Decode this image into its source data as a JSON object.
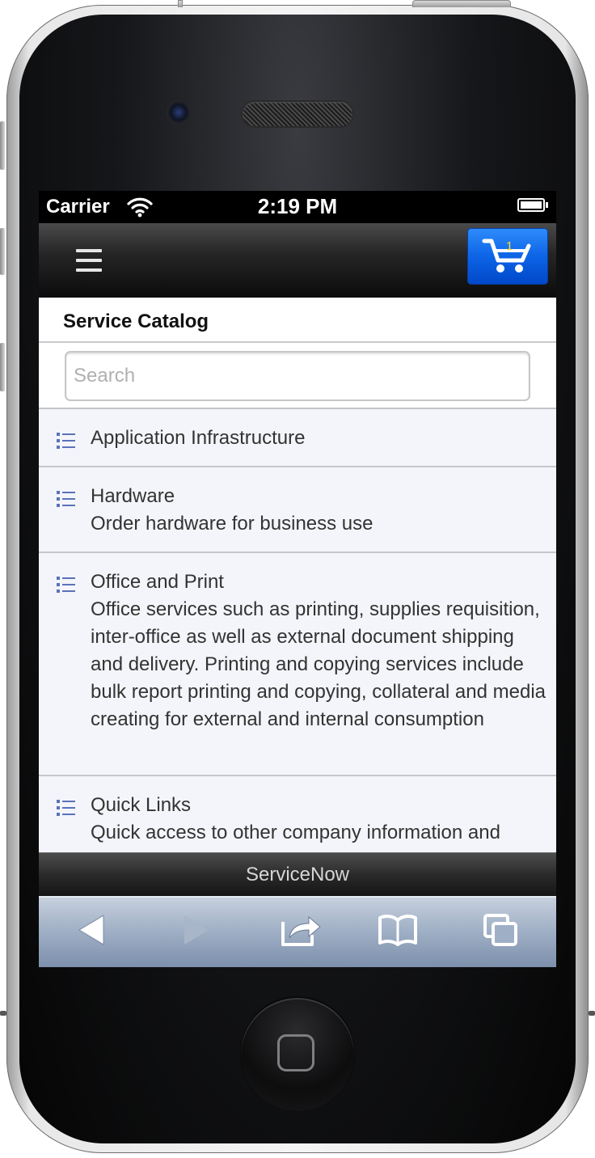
{
  "status_bar": {
    "carrier": "Carrier",
    "time": "2:19 PM"
  },
  "header": {
    "cart_count": "1"
  },
  "page": {
    "title": "Service Catalog"
  },
  "search": {
    "placeholder": "Search",
    "value": ""
  },
  "catalog": [
    {
      "title": "Application Infrastructure",
      "description": ""
    },
    {
      "title": "Hardware",
      "description": "Order hardware for business use"
    },
    {
      "title": "Office and Print",
      "description": "Office services such as printing, supplies requisition, inter-office as well as external document shipping and delivery. Printing and copying services include bulk report printing and copying, collateral and media creating for external and internal consumption"
    },
    {
      "title": "Quick Links",
      "description": "Quick access to other company information and"
    }
  ],
  "footer": {
    "text": "ServiceNow"
  },
  "toolbar": {
    "icons": [
      "back-icon",
      "forward-icon",
      "share-icon",
      "bookmarks-icon",
      "tabs-icon"
    ]
  },
  "colors": {
    "cart_button": "#0d64e6",
    "list_background": "#f4f5fa",
    "list_icon": "#5a72b8"
  }
}
